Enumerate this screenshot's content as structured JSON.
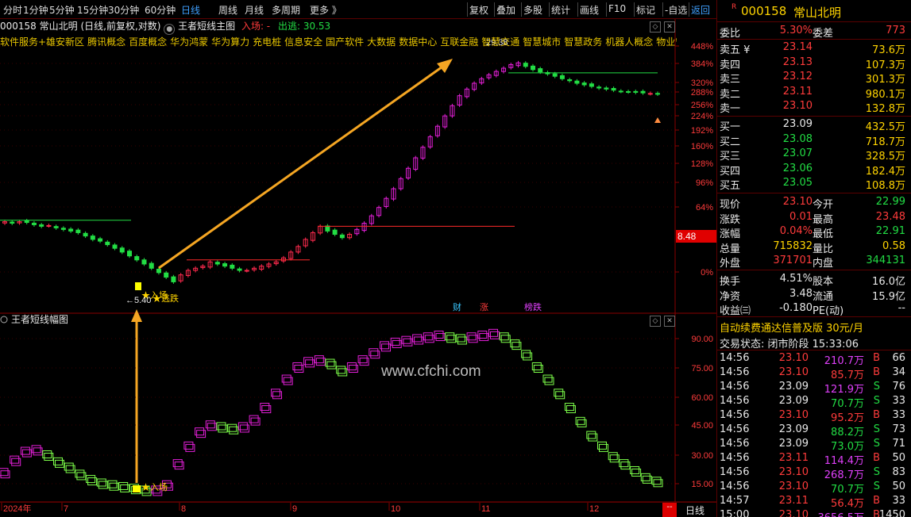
{
  "topbar": {
    "left_tabs": [
      "分时",
      "1分钟",
      "5分钟",
      "15分钟",
      "30分钟",
      "60分钟",
      "日线",
      "周线",
      "月线",
      "多周期",
      "更多 》"
    ],
    "active_tab": "日线",
    "right_buttons": [
      "复权",
      "叠加",
      "多股",
      "统计",
      "画线",
      "F10",
      "标记",
      "-自选",
      "返回"
    ]
  },
  "concepts": [
    "软件服务+雄安新区",
    "腾讯概念",
    "百度概念",
    "华为鸿蒙",
    "华为算力",
    "充电桩",
    "信息安全",
    "国产软件",
    "大数据",
    "数据中心",
    "互联金融",
    "智慧交通",
    "智慧城市",
    "智慧政务",
    "机器人概念",
    "物业管理"
  ],
  "main_chart": {
    "header_code": "000158",
    "header_name": "常山北明 (日线,前复权,对数)",
    "indicator_name": "王者短线主图",
    "entry_label": "入场: -",
    "exit_label": "出逃: 30.53",
    "y_ticks": [
      "448%",
      "384%",
      "320%",
      "288%",
      "256%",
      "224%",
      "192%",
      "160%",
      "128%",
      "96%",
      "64%",
      "0%"
    ],
    "current_price_tag": "8.48",
    "low_price_label": "←5.40",
    "entry_marker": "★入场",
    "exit_marker": "★逃跌",
    "high_price_label": "29.38",
    "event_labels": [
      "财",
      "涨",
      "榜跌"
    ],
    "colors": {
      "up": "#ff2a4e",
      "down": "#22dd44",
      "magenta": "#e21fd6",
      "arrow": "#f5a623",
      "axis": "#8a0000"
    }
  },
  "sub_chart": {
    "indicator_name": "王者短线幅图",
    "y_ticks": [
      "90.00",
      "75.00",
      "60.00",
      "45.00",
      "30.00",
      "15.00"
    ],
    "entry_marker": "★入场",
    "watermark": "www.cfchi.com",
    "series_values": [
      15,
      22,
      27,
      28,
      25,
      21,
      18,
      14,
      11,
      9,
      8,
      7,
      6,
      5,
      5,
      8,
      20,
      30,
      38,
      42,
      41,
      40,
      41,
      45,
      52,
      60,
      68,
      75,
      78,
      79,
      77,
      73,
      75,
      79,
      83,
      87,
      89,
      90,
      91,
      92,
      93,
      92,
      91,
      92,
      93,
      94,
      92,
      88,
      82,
      75,
      68,
      60,
      52,
      44,
      36,
      30,
      24,
      20,
      16,
      12,
      10
    ]
  },
  "bottomnav": {
    "x_labels": [
      "2024年",
      "7",
      "8",
      "9",
      "10",
      "11",
      "12"
    ],
    "period": "日线"
  },
  "right_panel": {
    "code": "000158",
    "name": "常山北明",
    "mark": "R",
    "weibi_label": "委比",
    "weibi": "5.30%",
    "weicha_label": "委差",
    "weicha": "773",
    "asks": [
      {
        "label": "卖五 ¥",
        "price": "23.14",
        "vol": "73.6万"
      },
      {
        "label": "卖四",
        "price": "23.13",
        "vol": "107.3万"
      },
      {
        "label": "卖三",
        "price": "23.12",
        "vol": "301.3万"
      },
      {
        "label": "卖二",
        "price": "23.11",
        "vol": "980.1万"
      },
      {
        "label": "卖一",
        "price": "23.10",
        "vol": "132.8万"
      }
    ],
    "bids": [
      {
        "label": "买一",
        "price": "23.09",
        "vol": "432.5万"
      },
      {
        "label": "买二",
        "price": "23.08",
        "vol": "718.7万"
      },
      {
        "label": "买三",
        "price": "23.07",
        "vol": "328.5万"
      },
      {
        "label": "买四",
        "price": "23.06",
        "vol": "182.4万"
      },
      {
        "label": "买五",
        "price": "23.05",
        "vol": "108.8万"
      }
    ],
    "stats": [
      {
        "l1": "现价",
        "v1": "23.10",
        "l2": "今开",
        "v2": "22.99"
      },
      {
        "l1": "涨跌",
        "v1": "0.01",
        "l2": "最高",
        "v2": "23.48"
      },
      {
        "l1": "涨幅",
        "v1": "0.04%",
        "l2": "最低",
        "v2": "22.91"
      },
      {
        "l1": "总量",
        "v1": "715832",
        "l2": "量比",
        "v2": "0.58"
      },
      {
        "l1": "外盘",
        "v1": "371701",
        "l2": "内盘",
        "v2": "344131"
      }
    ],
    "stats2": [
      {
        "l1": "换手",
        "v1": "4.51%",
        "l2": "股本",
        "v2": "16.0亿"
      },
      {
        "l1": "净资",
        "v1": "3.48",
        "l2": "流通",
        "v2": "15.9亿"
      },
      {
        "l1": "收益㈢",
        "v1": "-0.180",
        "l2": "PE(动)",
        "v2": "--"
      }
    ],
    "promo": "自动续费通达信普及版  30元/月",
    "trade_status": "交易状态: 闭市阶段 15:33:06",
    "ticks": [
      {
        "t": "14:56",
        "p": "23.10",
        "v": "210.7万",
        "s": "B",
        "n": "66"
      },
      {
        "t": "14:56",
        "p": "23.10",
        "v": "85.7万",
        "s": "B",
        "n": "34"
      },
      {
        "t": "14:56",
        "p": "23.09",
        "v": "121.9万",
        "s": "S",
        "n": "76"
      },
      {
        "t": "14:56",
        "p": "23.09",
        "v": "70.7万",
        "s": "S",
        "n": "33"
      },
      {
        "t": "14:56",
        "p": "23.10",
        "v": "95.2万",
        "s": "B",
        "n": "33"
      },
      {
        "t": "14:56",
        "p": "23.09",
        "v": "88.2万",
        "s": "S",
        "n": "73"
      },
      {
        "t": "14:56",
        "p": "23.09",
        "v": "73.0万",
        "s": "S",
        "n": "71"
      },
      {
        "t": "14:56",
        "p": "23.11",
        "v": "114.4万",
        "s": "B",
        "n": "50"
      },
      {
        "t": "14:56",
        "p": "23.10",
        "v": "268.7万",
        "s": "S",
        "n": "83"
      },
      {
        "t": "14:56",
        "p": "23.10",
        "v": "70.7万",
        "s": "S",
        "n": "50"
      },
      {
        "t": "14:57",
        "p": "23.11",
        "v": "56.4万",
        "s": "B",
        "n": "33"
      },
      {
        "t": "15:00",
        "p": "23.10",
        "v": "3656.5万",
        "s": "B",
        "n": "1450"
      }
    ]
  }
}
